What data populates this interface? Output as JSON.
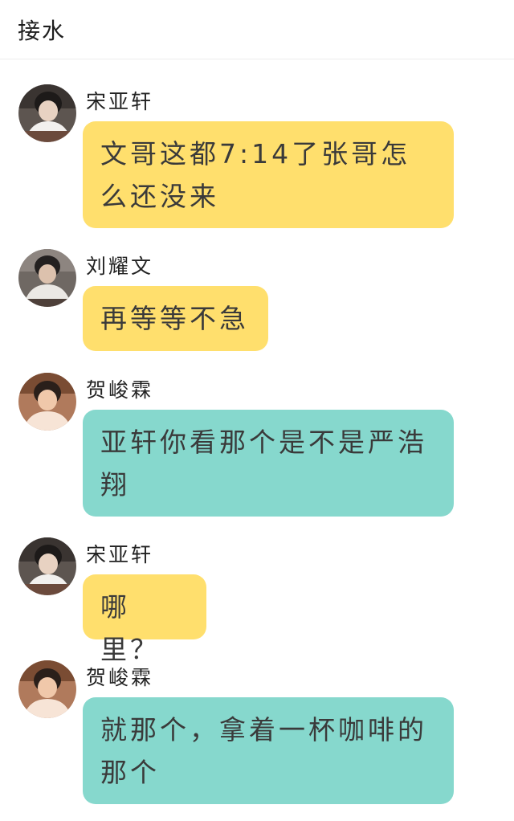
{
  "header": {
    "title": "接水"
  },
  "colors": {
    "yellow_bubble": "#ffdf6d",
    "teal_bubble": "#86d8cd"
  },
  "messages": [
    {
      "sender": "宋亚轩",
      "text": "文哥这都7:14了张哥怎么还没来",
      "bubble_color": "yellow",
      "avatar": "avatar-songyaxuan"
    },
    {
      "sender": "刘耀文",
      "text": "再等等不急",
      "bubble_color": "yellow",
      "avatar": "avatar-liuyaowen"
    },
    {
      "sender": "贺峻霖",
      "text": "亚轩你看那个是不是严浩翔",
      "bubble_color": "teal",
      "avatar": "avatar-hejunlin"
    },
    {
      "sender": "宋亚轩",
      "text": "哪里？",
      "bubble_color": "yellow",
      "avatar": "avatar-songyaxuan"
    },
    {
      "sender": "贺峻霖",
      "text": "就那个，拿着一杯咖啡的那个",
      "bubble_color": "teal",
      "avatar": "avatar-hejunlin"
    }
  ]
}
